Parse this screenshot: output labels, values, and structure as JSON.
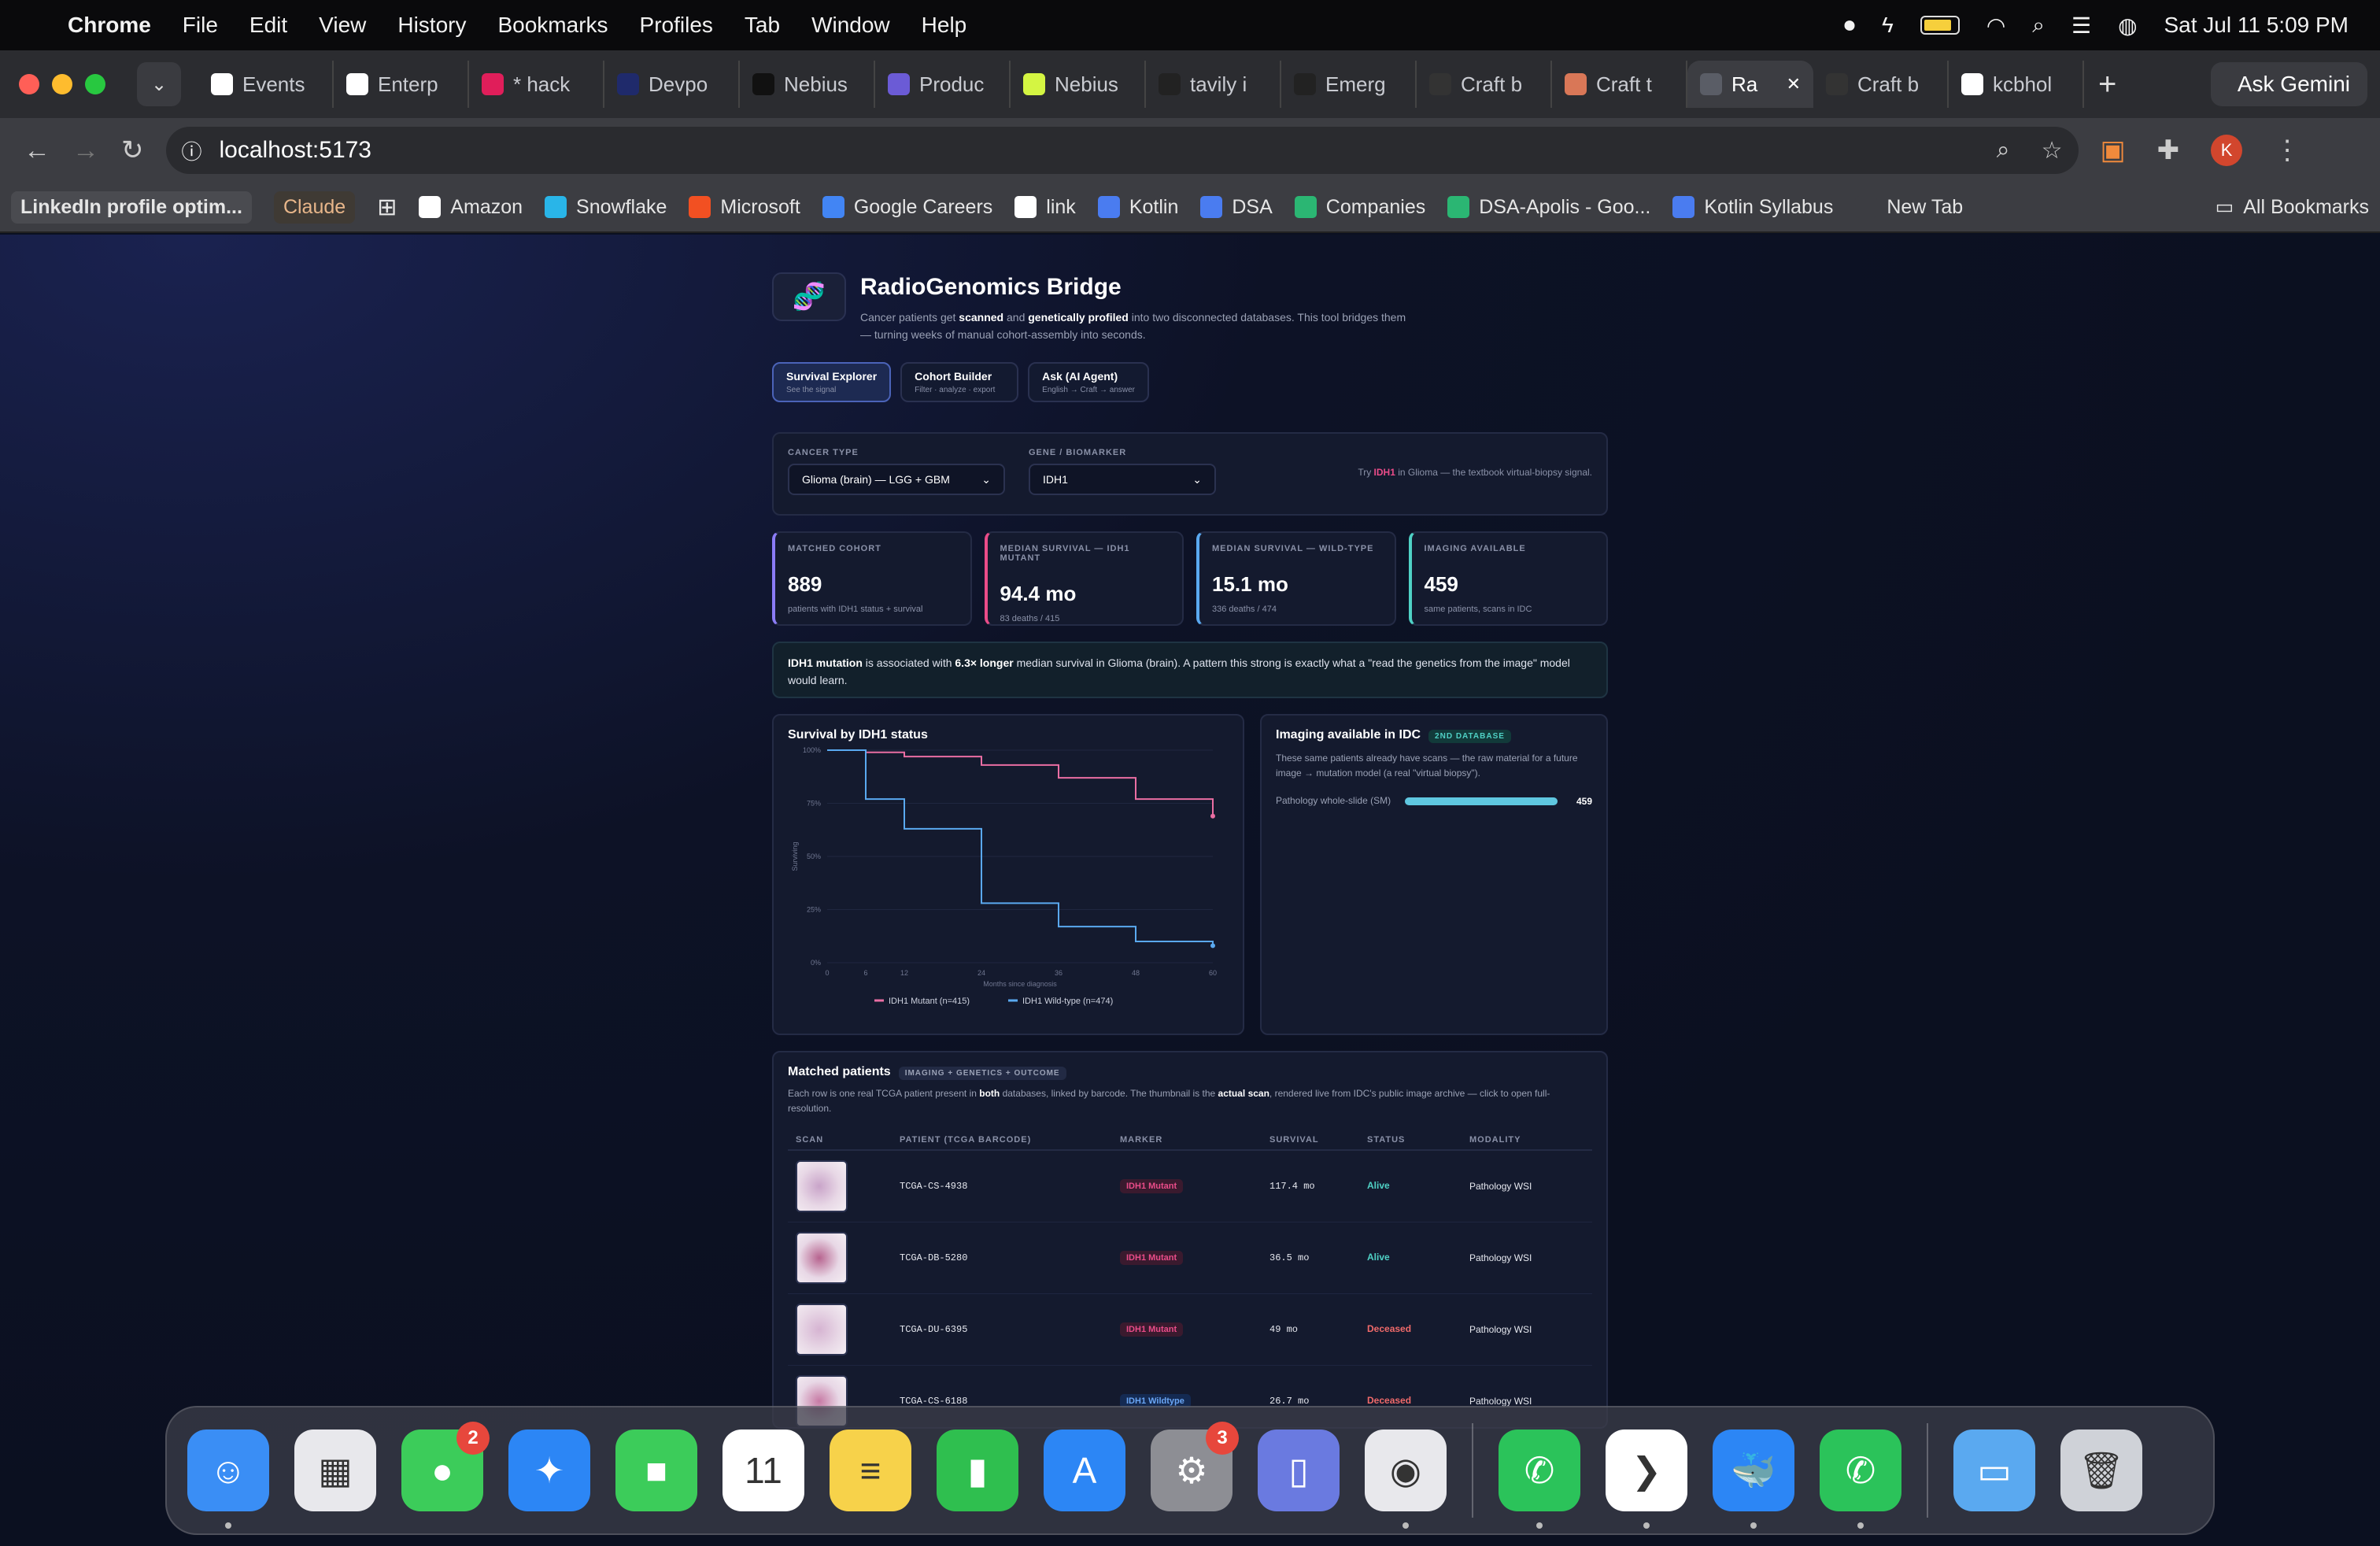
{
  "menubar": {
    "app": "Chrome",
    "items": [
      "File",
      "Edit",
      "View",
      "History",
      "Bookmarks",
      "Profiles",
      "Tab",
      "Window",
      "Help"
    ],
    "clock": "Sat Jul 11  5:09 PM"
  },
  "tabs": [
    {
      "label": "Events",
      "color": "#ffffff"
    },
    {
      "label": "Enterp",
      "color": "#ffffff"
    },
    {
      "label": "* hack",
      "color": "#e01e5a"
    },
    {
      "label": "Devpo",
      "color": "#1f2a6b"
    },
    {
      "label": "Nebius",
      "color": "#111111"
    },
    {
      "label": "Produc",
      "color": "#6b5bd6"
    },
    {
      "label": "Nebius",
      "color": "#d4f542"
    },
    {
      "label": "tavily i",
      "color": "#222222"
    },
    {
      "label": "Emerg",
      "color": "#222222"
    },
    {
      "label": "Craft b",
      "color": "#333333"
    },
    {
      "label": "Craft t",
      "color": "#d97757"
    },
    {
      "label": "Ra",
      "color": "#5a5d66"
    },
    {
      "label": "Craft b",
      "color": "#333333"
    },
    {
      "label": "kcbhol",
      "color": "#ffffff"
    }
  ],
  "ask_gemini": "Ask Gemini",
  "url": "localhost:5173",
  "avatar_letter": "K",
  "bookmarks": [
    {
      "label": "Amazon",
      "color": "#ffffff"
    },
    {
      "label": "Snowflake",
      "color": "#29b5e8"
    },
    {
      "label": "Microsoft",
      "color": "#f25022"
    },
    {
      "label": "Google Careers",
      "color": "#4285f4"
    },
    {
      "label": "link",
      "color": "#ffffff"
    },
    {
      "label": "Kotlin",
      "color": "#4a7cf0"
    },
    {
      "label": "DSA",
      "color": "#4a7cf0"
    },
    {
      "label": "Companies",
      "color": "#2bb673"
    },
    {
      "label": "DSA-Apolis - Goo...",
      "color": "#2bb673"
    },
    {
      "label": "Kotlin Syllabus",
      "color": "#4a7cf0"
    },
    {
      "label": "New Tab",
      "color": "#3c3d42"
    }
  ],
  "bookmark_linkedin": "LinkedIn profile optim...",
  "bookmark_claude": "Claude",
  "all_bookmarks": "All Bookmarks",
  "app": {
    "title": "RadioGenomics Bridge",
    "subtitle_pre": "Cancer patients get ",
    "subtitle_b1": "scanned",
    "subtitle_mid": " and ",
    "subtitle_b2": "genetically profiled",
    "subtitle_post": " into two disconnected databases. This tool bridges them — turning weeks of manual cohort-assembly into seconds.",
    "modes": [
      {
        "title": "Survival Explorer",
        "sub": "See the signal"
      },
      {
        "title": "Cohort Builder",
        "sub": "Filter · analyze · export"
      },
      {
        "title": "Ask (AI Agent)",
        "sub": "English → Craft → answer"
      }
    ],
    "filters": {
      "cancer_label": "CANCER TYPE",
      "cancer_value": "Glioma (brain) — LGG + GBM",
      "gene_label": "GENE / BIOMARKER",
      "gene_value": "IDH1",
      "hint_pre": "Try ",
      "hint_gene": "IDH1",
      "hint_post": " in Glioma — the textbook virtual-biopsy signal."
    },
    "stats": [
      {
        "label": "MATCHED COHORT",
        "value": "889",
        "detail": "patients with IDH1 status + survival",
        "color": "#8b7cf6"
      },
      {
        "label": "MEDIAN SURVIVAL — IDH1 MUTANT",
        "value": "94.4 mo",
        "detail": "83 deaths / 415",
        "color": "#ea4c89"
      },
      {
        "label": "MEDIAN SURVIVAL — WILD-TYPE",
        "value": "15.1 mo",
        "detail": "336 deaths / 474",
        "color": "#5aa9f0"
      },
      {
        "label": "IMAGING AVAILABLE",
        "value": "459",
        "detail": "same patients, scans in IDC",
        "color": "#4fd1c5"
      }
    ],
    "insight": {
      "b1": "IDH1 mutation",
      "t1": " is associated with ",
      "b2": "6.3× longer",
      "t2": " median survival in Glioma (brain). A pattern this strong is exactly what a \"read the genetics from the image\" model would learn."
    },
    "imaging": {
      "title": "Imaging available in IDC",
      "badge": "2ND DATABASE",
      "desc": "These same patients already have scans — the raw material for a future image → mutation model (a real \"virtual biopsy\").",
      "bar_label": "Pathology whole-slide (SM)",
      "bar_value": "459",
      "bar_fraction": 1.0
    },
    "patients": {
      "title": "Matched patients",
      "badge": "IMAGING + GENETICS + OUTCOME",
      "desc_pre": "Each row is one real TCGA patient present in ",
      "desc_b1": "both",
      "desc_mid": " databases, linked by barcode. The thumbnail is the ",
      "desc_b2": "actual scan",
      "desc_post": ", rendered live from IDC's public image archive — click to open full-resolution.",
      "columns": [
        "SCAN",
        "PATIENT (TCGA BARCODE)",
        "MARKER",
        "SURVIVAL",
        "STATUS",
        "MODALITY"
      ],
      "rows": [
        {
          "barcode": "TCGA-CS-4938",
          "marker": "IDH1 Mutant",
          "survival": "117.4 mo",
          "status": "Alive",
          "modality": "Pathology WSI"
        },
        {
          "barcode": "TCGA-DB-5280",
          "marker": "IDH1 Mutant",
          "survival": "36.5 mo",
          "status": "Alive",
          "modality": "Pathology WSI"
        },
        {
          "barcode": "TCGA-DU-6395",
          "marker": "IDH1 Mutant",
          "survival": "49 mo",
          "status": "Deceased",
          "modality": "Pathology WSI"
        },
        {
          "barcode": "TCGA-CS-6188",
          "marker": "IDH1 Wildtype",
          "survival": "26.7 mo",
          "status": "Deceased",
          "modality": "Pathology WSI"
        }
      ]
    }
  },
  "chart_data": {
    "type": "line",
    "title": "Survival by IDH1 status",
    "xlabel": "Months since diagnosis",
    "ylabel": "Surviving",
    "x_ticks": [
      0,
      6,
      12,
      24,
      36,
      48,
      60
    ],
    "y_ticks": [
      "0%",
      "25%",
      "50%",
      "75%",
      "100%"
    ],
    "xlim": [
      0,
      60
    ],
    "ylim": [
      0,
      1
    ],
    "legend": "bottom",
    "series": [
      {
        "name": "IDH1 Mutant (n=415)",
        "color": "#ea6ea3",
        "x": [
          0,
          6,
          12,
          24,
          36,
          48,
          60
        ],
        "y": [
          1.0,
          0.99,
          0.97,
          0.93,
          0.87,
          0.77,
          0.69
        ]
      },
      {
        "name": "IDH1 Wild-type (n=474)",
        "color": "#5aa9f0",
        "x": [
          0,
          6,
          12,
          24,
          36,
          48,
          60
        ],
        "y": [
          1.0,
          0.77,
          0.63,
          0.28,
          0.17,
          0.1,
          0.08
        ]
      }
    ]
  },
  "dock": [
    {
      "name": "finder",
      "color": "#3a8ef5",
      "glyph": "☺"
    },
    {
      "name": "launchpad",
      "color": "#e8e8ec",
      "glyph": "▦"
    },
    {
      "name": "messages",
      "color": "#3ccc5a",
      "glyph": "●",
      "badge": "2"
    },
    {
      "name": "safari",
      "color": "#2c86f5",
      "glyph": "✦"
    },
    {
      "name": "facetime",
      "color": "#3ccc5a",
      "glyph": "■"
    },
    {
      "name": "calendar",
      "color": "#ffffff",
      "glyph": "11"
    },
    {
      "name": "notes",
      "color": "#f7d24a",
      "glyph": "≡"
    },
    {
      "name": "numbers",
      "color": "#2fbf4f",
      "glyph": "▮"
    },
    {
      "name": "app-store",
      "color": "#2c86f5",
      "glyph": "A"
    },
    {
      "name": "system-settings",
      "color": "#8d8e94",
      "glyph": "⚙",
      "badge": "3"
    },
    {
      "name": "simulator",
      "color": "#6a7ae0",
      "glyph": "▯"
    },
    {
      "name": "chrome",
      "color": "#e8e8ec",
      "glyph": "◉"
    },
    {
      "name": "whatsapp",
      "color": "#2bc35a",
      "glyph": "✆"
    },
    {
      "name": "vscode",
      "color": "#ffffff",
      "glyph": "❯"
    },
    {
      "name": "docker",
      "color": "#2c86f5",
      "glyph": "🐳"
    },
    {
      "name": "whatsapp-beta",
      "color": "#2bc35a",
      "glyph": "✆"
    },
    {
      "name": "downloads-folder",
      "color": "#5aa9f0",
      "glyph": "▭"
    },
    {
      "name": "trash",
      "color": "#cfd2d8",
      "glyph": "🗑"
    }
  ]
}
